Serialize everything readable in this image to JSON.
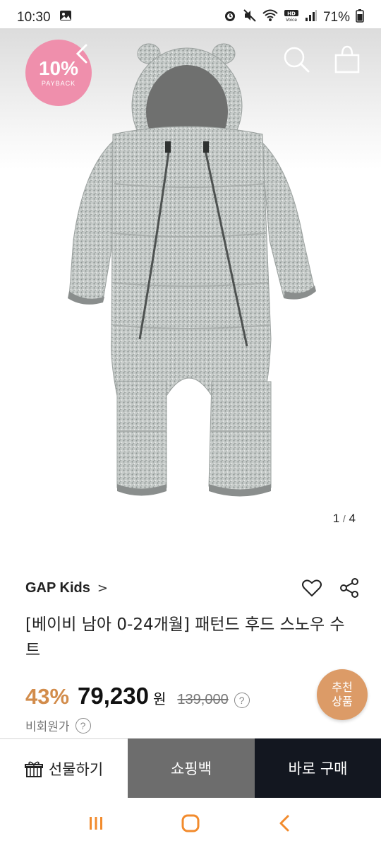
{
  "status": {
    "time": "10:30",
    "battery": "71%",
    "icons": [
      "image-icon",
      "alarm-icon",
      "mute-icon",
      "wifi-icon",
      "hd-voice-icon",
      "signal-icon",
      "battery-icon"
    ]
  },
  "hero": {
    "badge_big": "10%",
    "badge_small": "PAYBACK",
    "counter_current": "1",
    "counter_sep": "/",
    "counter_total": "4",
    "icons": [
      "back-icon",
      "search-icon",
      "bag-icon"
    ]
  },
  "product": {
    "brand": "GAP Kids",
    "brand_chevron": ">",
    "title": "[베이비 남아 0-24개월] 패턴드 후드 스노우 수트",
    "discount": "43%",
    "price": "79,230",
    "currency": "원",
    "original_price": "139,000",
    "member_note": "비회원가",
    "help_glyph": "?"
  },
  "recommend": {
    "line1": "추천",
    "line2": "상품"
  },
  "bottom_bar": {
    "gift": "선물하기",
    "bag": "쇼핑백",
    "buy": "바로 구매"
  },
  "colors": {
    "badge_pink": "#ef8fac",
    "discount_orange": "#d28c4b",
    "recommend_orange": "#dc9b67",
    "buy_dark": "#131720",
    "bag_gray": "#6d6d6d",
    "nav_orange": "#f28b2d"
  }
}
